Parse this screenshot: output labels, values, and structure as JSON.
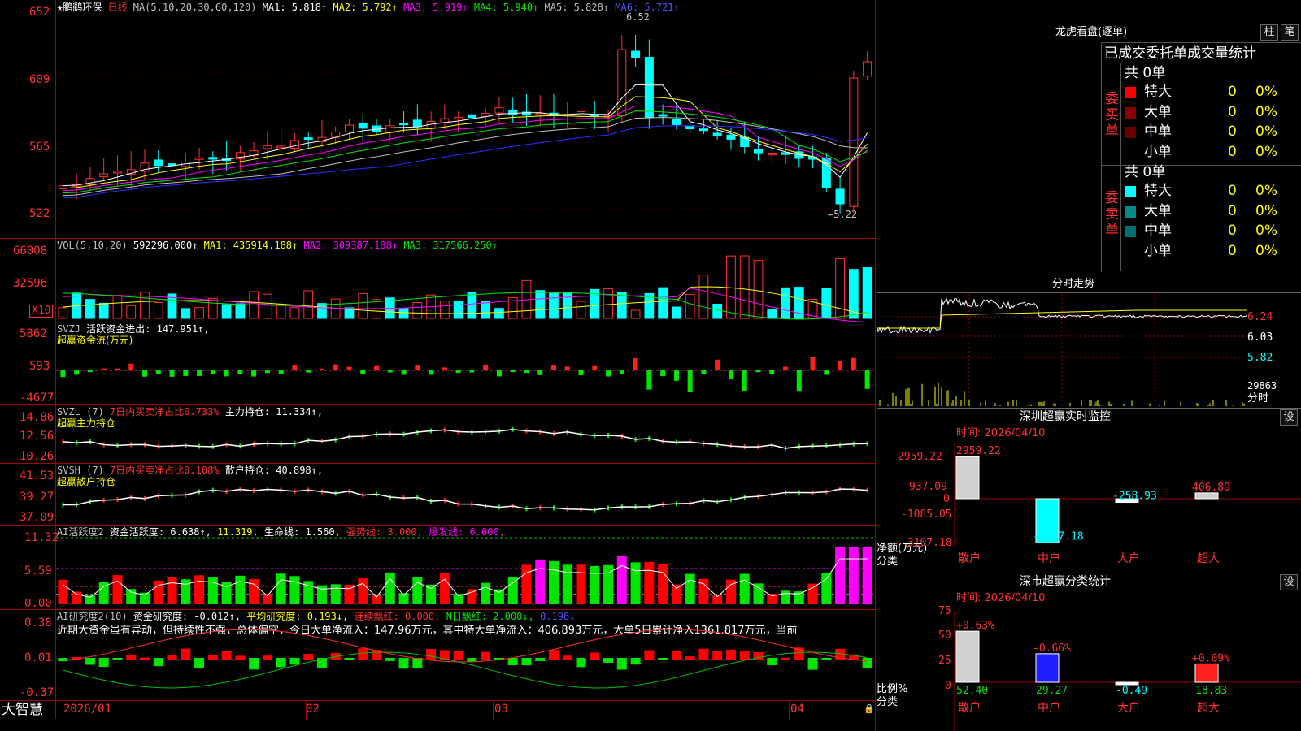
{
  "stock": {
    "star": "★",
    "name": "鹏鹞环保",
    "period": "日线"
  },
  "ma_line": {
    "label": "MA(5,10,20,30,60,120)",
    "ma1": "MA1: 5.818↑",
    "ma2": "MA2: 5.792↑",
    "ma3": "MA3: 5.919↑",
    "ma4": "MA4: 5.940↑",
    "ma5": "MA5: 5.828↑",
    "ma6": "MA6: 5.721↑"
  },
  "price_axis": [
    "652",
    "609",
    "565",
    "522"
  ],
  "price_marks": {
    "high": "6.52",
    "low": "←5.22"
  },
  "vol": {
    "label": "VOL(5,10,20)",
    "v": "592296.000↑",
    "ma1": "MA1: 435914.188↑",
    "ma2": "MA2: 309387.188↑",
    "ma3": "MA3: 317566.250↑",
    "axis": [
      "66008",
      "32596"
    ],
    "unit": "X10"
  },
  "svzj": {
    "label": "SVZJ",
    "desc": "活跃资金进出: 147.951↑,",
    "sub": "超赢资金流(万元)",
    "axis": [
      "5862",
      "593",
      "-4677"
    ]
  },
  "svzl": {
    "label": "SVZL (7)",
    "desc": "7日内买卖净占比0.733%",
    "hold": "主力持仓: 11.334↑,",
    "sub": "超赢主力持仓",
    "axis": [
      "14.86",
      "12.56",
      "10.26"
    ]
  },
  "svsh": {
    "label": "SVSH (7)",
    "desc": "7日内买卖净占比0.108%",
    "hold": "散户持仓: 40.898↑,",
    "sub": "超赢散户持仓",
    "axis": [
      "41.53",
      "39.27",
      "37.09"
    ]
  },
  "ai_active": {
    "label": "AI活跃度2",
    "a": "资金活跃度: 6.638↑,",
    "b": "11.319,",
    "c": "生命线: 1.560,",
    "d": "强势线: 3.000,",
    "e": "爆发线: 6.000,",
    "axis": [
      "11.32",
      "5.59",
      "0.00"
    ]
  },
  "ai_research": {
    "label": "AI研究度2(10)",
    "a": "资金研究度: -0.012↑,",
    "b": "平均研究度: 0.193↓,",
    "c": "连续飘红: 0.000,",
    "d": "N日飘红: 2.000↓,",
    "e": "0.198↓",
    "axis": [
      "0.38",
      "0.01",
      "-0.37"
    ],
    "comment": "近期大资金虽有异动，但持续性不强，总体偏空，今日大单净流入：147.96万元，其中特大单净流入：406.893万元，大单5日累计净入1361.817万元，当前"
  },
  "date_axis": [
    "2026/01",
    "02",
    "03",
    "04"
  ],
  "brand": "大智慧",
  "panel_top": {
    "title": "龙虎看盘(逐单)",
    "btn1": "柱",
    "btn2": "笔",
    "header": "已成交委托单成交量统计",
    "buy": {
      "side": "委买单",
      "total": "共 0单",
      "rows": [
        {
          "label": "特大",
          "n": "0",
          "p": "0%"
        },
        {
          "label": "大单",
          "n": "0",
          "p": "0%"
        },
        {
          "label": "中单",
          "n": "0",
          "p": "0%"
        },
        {
          "label": "小单",
          "n": "0",
          "p": "0%"
        }
      ]
    },
    "sell": {
      "side": "委卖单",
      "total": "共 0单",
      "rows": [
        {
          "label": "特大",
          "n": "0",
          "p": "0%"
        },
        {
          "label": "大单",
          "n": "0",
          "p": "0%"
        },
        {
          "label": "中单",
          "n": "0",
          "p": "0%"
        },
        {
          "label": "小单",
          "n": "0",
          "p": "0%"
        }
      ]
    }
  },
  "intraday": {
    "title": "分时走势",
    "axis": [
      "6.24",
      "6.03",
      "5.82",
      "29863"
    ],
    "unit": "分时"
  },
  "sz_monitor": {
    "title": "深圳超赢实时监控",
    "btn": "设",
    "time": "时间: 2026/04/10",
    "axis": [
      "2959.22",
      "937.09",
      "0",
      "-1085.05",
      "-3107.18"
    ],
    "ylabel": "净额(万元)",
    "xlabel": "分类",
    "bars": [
      {
        "cat": "散户",
        "value": "2959.22"
      },
      {
        "cat": "中户",
        "value": "-3107.18"
      },
      {
        "cat": "大户",
        "value": "-258.93"
      },
      {
        "cat": "超大",
        "value": "406.89"
      }
    ]
  },
  "sz_class": {
    "title": "深市超赢分类统计",
    "btn": "设",
    "time": "时间: 2026/04/10",
    "axis": [
      "75",
      "50",
      "25",
      "0"
    ],
    "ylabel": "比例%",
    "xlabel": "分类",
    "bars": [
      {
        "cat": "散户",
        "value": "52.40",
        "chg": "+0.63%"
      },
      {
        "cat": "中户",
        "value": "29.27",
        "chg": "-0.66%"
      },
      {
        "cat": "大户",
        "value": "-0.49",
        "chg": ""
      },
      {
        "cat": "超大",
        "value": "18.83",
        "chg": "+0.09%"
      }
    ]
  },
  "colors": {
    "up": "#ff3232",
    "down": "#00ffff",
    "grid": "#a00000"
  }
}
